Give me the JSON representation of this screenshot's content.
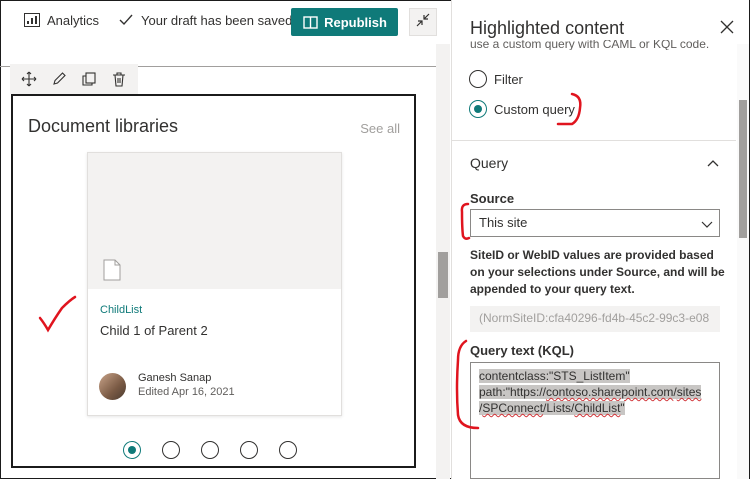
{
  "toolbar": {
    "analytics_label": "Analytics",
    "analytics_icon": "analytics-icon",
    "saved_label": "Your draft has been saved",
    "saved_icon": "checkmark-icon",
    "republish_label": "Republish",
    "republish_icon": "book-icon",
    "collapse_icon": "collapse-arrows-icon",
    "accent": "#0f7a79"
  },
  "edit_tools": [
    "move-icon",
    "pencil-icon",
    "duplicate-icon",
    "trash-icon"
  ],
  "webpart": {
    "title": "Document libraries",
    "see_all": "See all",
    "card": {
      "category": "ChildList",
      "name": "Child 1 of Parent 2",
      "author": "Ganesh Sanap",
      "edited": "Edited Apr 16, 2021",
      "icon": "document-icon"
    },
    "pager": {
      "pages": 5,
      "active": 1
    }
  },
  "pane": {
    "title": "Highlighted content",
    "truncated_text": "use a custom query with CAML or KQL code.",
    "radios": [
      {
        "label": "Filter",
        "checked": false
      },
      {
        "label": "Custom query",
        "checked": true
      }
    ],
    "query_section": "Query",
    "source_label": "Source",
    "source_value": "This site",
    "help_text": "SiteID or WebID values are provided based on your selections under Source, and will be appended to your query text.",
    "siteid_value": "(NormSiteID:cfa40296-fd4b-45c2-99c3-e08",
    "query_text_label": "Query text (KQL)",
    "query_line1": "contentclass:\"STS_ListItem\"",
    "query_line2_a": "path:\"https://",
    "query_line2_b": "contoso.sharepoint.com",
    "query_line2_c": "/",
    "query_line2_d": "sites",
    "query_line3_a": "/",
    "query_line3_b": "SPConnect",
    "query_line3_c": "/Lists/",
    "query_line3_d": "ChildList",
    "query_line3_e": "\""
  },
  "annotation_color": "#e0141e"
}
